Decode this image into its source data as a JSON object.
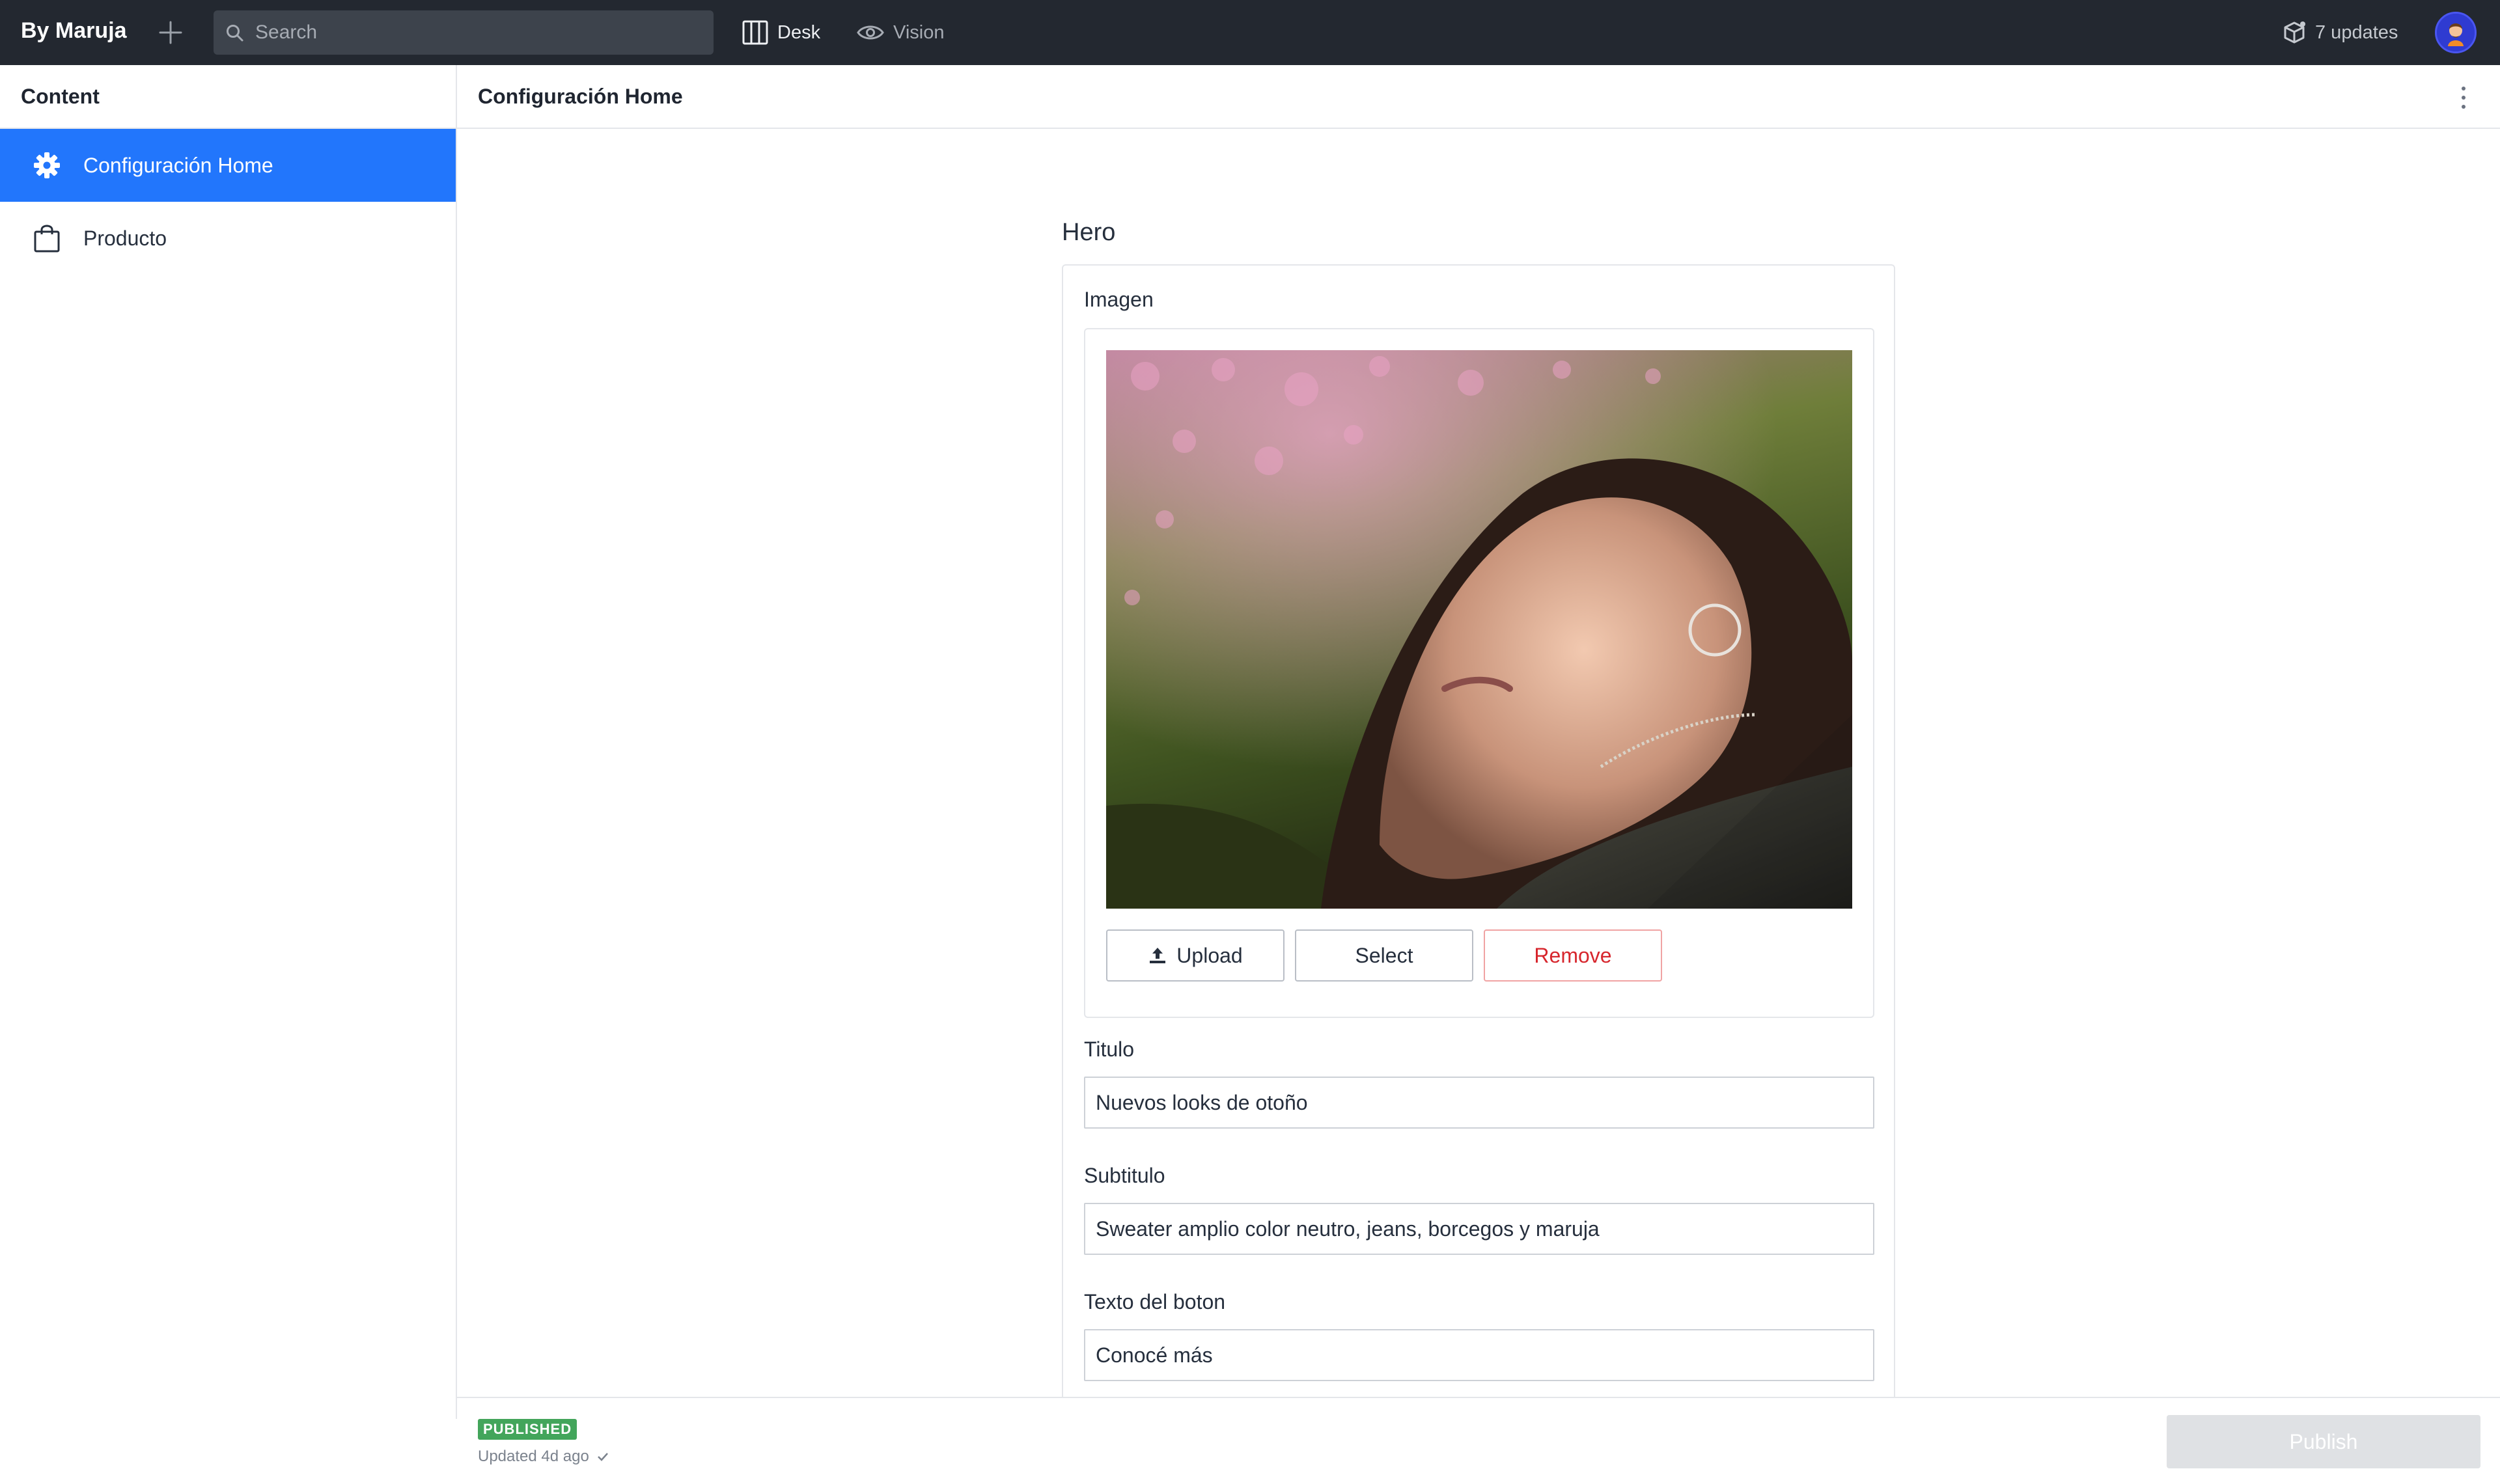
{
  "topbar": {
    "brand": "By Maruja",
    "search_placeholder": "Search",
    "tools": {
      "desk": "Desk",
      "vision": "Vision"
    },
    "updates": "7 updates"
  },
  "sidebar": {
    "title": "Content",
    "items": [
      {
        "label": "Configuración Home",
        "icon": "gear-icon",
        "active": true
      },
      {
        "label": "Producto",
        "icon": "shopping-bag-icon",
        "active": false
      }
    ]
  },
  "document": {
    "title": "Configuración Home",
    "section": "Hero",
    "image": {
      "label": "Imagen",
      "upload_label": "Upload",
      "select_label": "Select",
      "remove_label": "Remove"
    },
    "fields": {
      "titulo": {
        "label": "Titulo",
        "value": "Nuevos looks de otoño"
      },
      "subtitulo": {
        "label": "Subtitulo",
        "value": "Sweater amplio color neutro, jeans, borcegos y maruja"
      },
      "boton": {
        "label": "Texto del boton",
        "value": "Conocé más"
      }
    }
  },
  "footer": {
    "status": "PUBLISHED",
    "updated": "Updated 4d ago",
    "publish_label": "Publish"
  },
  "colors": {
    "topbar": "#232830",
    "accent": "#2276fc",
    "published": "#43a55b",
    "danger": "#d7262d"
  }
}
